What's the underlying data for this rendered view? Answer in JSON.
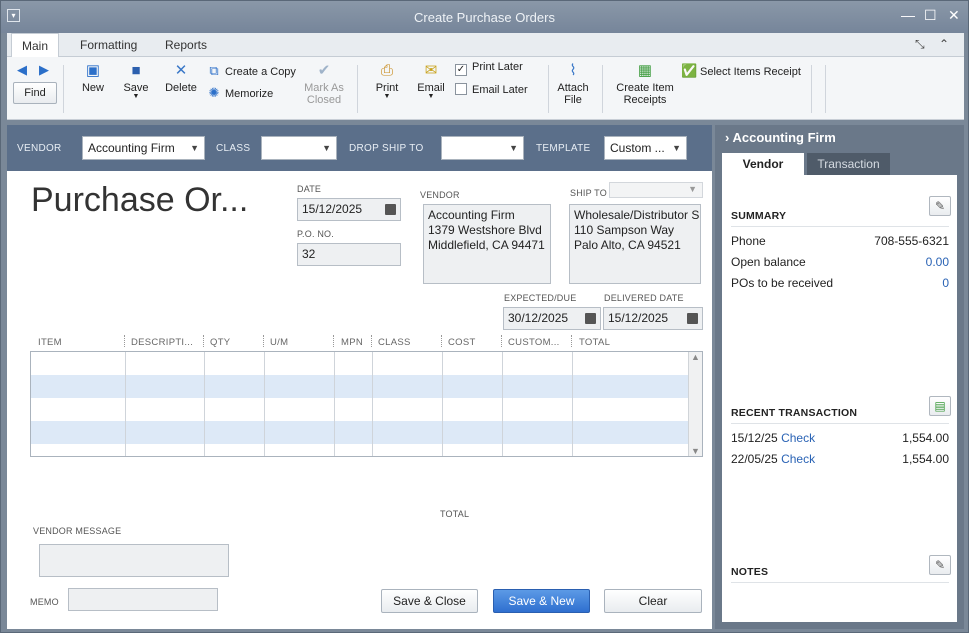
{
  "window": {
    "title": "Create Purchase Orders"
  },
  "tabs": [
    "Main",
    "Formatting",
    "Reports"
  ],
  "toolbar": {
    "find": "Find",
    "new": "New",
    "save": "Save",
    "delete": "Delete",
    "create_copy": "Create a Copy",
    "memorize": "Memorize",
    "mark_as_closed_1": "Mark As",
    "mark_as_closed_2": "Closed",
    "print": "Print",
    "email": "Email",
    "print_later": "Print Later",
    "email_later": "Email Later",
    "attach_1": "Attach",
    "attach_2": "File",
    "create_receipts_1": "Create Item",
    "create_receipts_2": "Receipts",
    "select_items_receipt": "Select Items Receipt"
  },
  "header": {
    "vendor_label": "VENDOR",
    "vendor_value": "Accounting Firm",
    "class_label": "CLASS",
    "class_value": "",
    "drop_ship_label": "DROP SHIP TO",
    "drop_ship_value": "",
    "template_label": "TEMPLATE",
    "template_value": "Custom ..."
  },
  "form": {
    "title": "Purchase Or...",
    "date_label": "DATE",
    "date": "15/12/2025",
    "po_label": "P.O. NO.",
    "po_no": "32",
    "vendor_label": "VENDOR",
    "vendor_address": [
      "Accounting Firm",
      "1379 Westshore Blvd",
      "Middlefield, CA 94471"
    ],
    "ship_to_label": "SHIP TO",
    "ship_to_address": [
      "Wholesale/Distributor S",
      "110 Sampson Way",
      "Palo Alto, CA  94521"
    ],
    "expected_label": "EXPECTED/DUE",
    "expected": "30/12/2025",
    "delivered_label": "DELIVERED DATE",
    "delivered": "15/12/2025",
    "columns": [
      "ITEM",
      "DESCRIPTI...",
      "QTY",
      "U/M",
      "MPN",
      "CLASS",
      "COST",
      "CUSTOM...",
      "TOTAL"
    ],
    "total_label": "TOTAL",
    "vendor_message_label": "VENDOR MESSAGE",
    "memo_label": "MEMO",
    "save_close": "Save & Close",
    "save_new": "Save & New",
    "clear": "Clear"
  },
  "sidebar": {
    "heading": "Accounting Firm",
    "tab_vendor": "Vendor",
    "tab_transaction": "Transaction",
    "summary_label": "SUMMARY",
    "summary": [
      {
        "label": "Phone",
        "value": "708-555-6321"
      },
      {
        "label": "Open balance",
        "value": "0.00"
      },
      {
        "label": "POs to be received",
        "value": "0"
      }
    ],
    "recent_label": "RECENT TRANSACTION",
    "recent": [
      {
        "date": "15/12/25",
        "type": "Check",
        "amount": "1,554.00"
      },
      {
        "date": "22/05/25",
        "type": "Check",
        "amount": "1,554.00"
      }
    ],
    "notes_label": "NOTES"
  }
}
